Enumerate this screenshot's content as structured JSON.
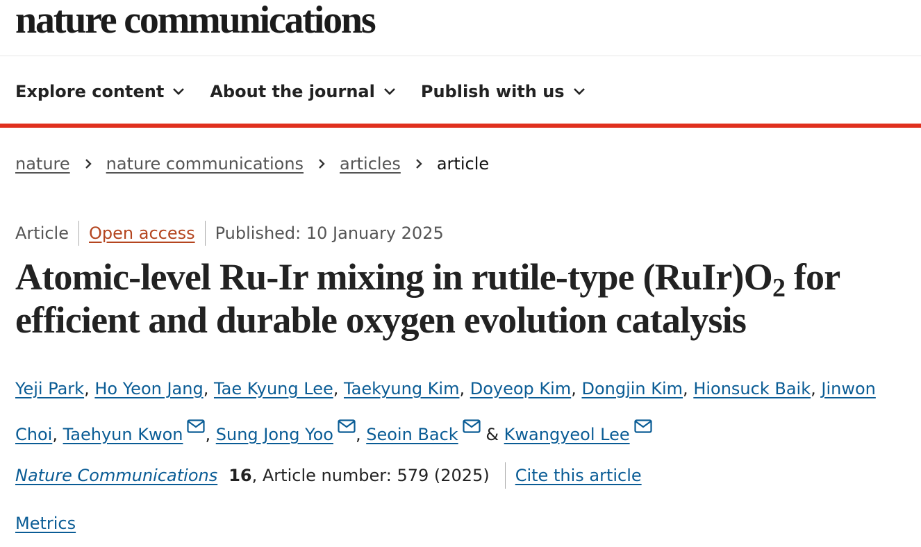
{
  "header": {
    "logo": "nature communications"
  },
  "nav": {
    "items": [
      {
        "label": "Explore content"
      },
      {
        "label": "About the journal"
      },
      {
        "label": "Publish with us"
      }
    ]
  },
  "breadcrumb": {
    "items": [
      "nature",
      "nature communications",
      "articles"
    ],
    "current": "article"
  },
  "meta": {
    "type": "Article",
    "access": "Open access",
    "published": "Published: 10 January 2025"
  },
  "article": {
    "title_part1": "Atomic-level Ru-Ir mixing in rutile-type (RuIr)O",
    "title_sub": "2",
    "title_part2": " for efficient and durable oxygen evolution catalysis"
  },
  "authors": [
    {
      "name": "Yeji Park",
      "sep": ", "
    },
    {
      "name": "Ho Yeon Jang",
      "sep": ", "
    },
    {
      "name": "Tae Kyung Lee",
      "sep": ", "
    },
    {
      "name": "Taekyung Kim",
      "sep": ", "
    },
    {
      "name": "Doyeop Kim",
      "sep": ", "
    },
    {
      "name": "Dongjin Kim",
      "sep": ", "
    },
    {
      "name": "Hionsuck Baik",
      "sep": ", "
    },
    {
      "name": "Jinwon Choi",
      "sep": ", "
    },
    {
      "name": "Taehyun Kwon",
      "sep": ", "
    },
    {
      "name": "Sung Jong Yoo",
      "sep": ", "
    },
    {
      "name": "Seoin Back",
      "sep": " & "
    },
    {
      "name": "Kwangyeol Lee",
      "sep": ""
    }
  ],
  "citation": {
    "journal": "Nature Communications",
    "volume": "16",
    "article_number": ", Article number: 579 (2025)",
    "cite_label": "Cite this article"
  },
  "metrics_label": "Metrics",
  "colors": {
    "accent_red": "#e0301e",
    "link_blue": "#0a5c95",
    "open_access_orange": "#b4451f"
  },
  "icons": {
    "nav_chevron": "chevron-down-icon",
    "breadcrumb_separator": "chevron-right-icon",
    "author_contact": "envelope-icon"
  }
}
